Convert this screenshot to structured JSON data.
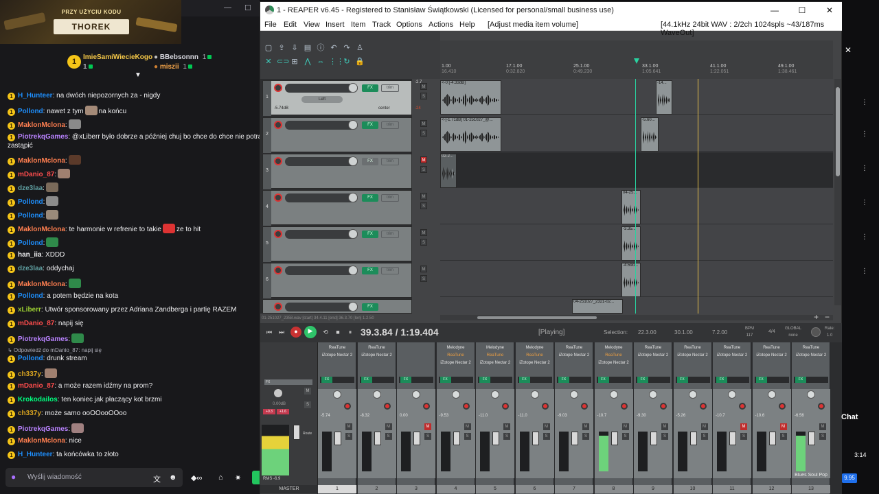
{
  "promo": {
    "top_text": "PRZY UŻYCIU KODU",
    "code": "THOREK"
  },
  "leaders": {
    "first_name": "ImieSamiWiecieKogo",
    "first_count": "1",
    "second_name": "BBebsonnn",
    "second_count": "1",
    "third_name": "miszii",
    "third_count": "1"
  },
  "chat": {
    "messages": [
      {
        "user": "H_Hunteer",
        "color": "#1e90ff",
        "text": ": na dwóch niepozornych za - nigdy"
      },
      {
        "user": "Pollond",
        "color": "#1e90ff",
        "text": ": nawet z tym",
        "after": "na końcu"
      },
      {
        "user": "MaklonMclona",
        "color": "#ff7f50",
        "text": ":"
      },
      {
        "user": "PiotrekqGames",
        "color": "#b983ff",
        "text": ": @xLiberr było dobrze a później chuj bo chce do chce nie potrafię"
      },
      {
        "user": "",
        "color": "#efeff1",
        "text": "zastąpić"
      },
      {
        "user": "MaklonMclona",
        "color": "#ff7f50",
        "text": ":"
      },
      {
        "user": "mDanio_87",
        "color": "#ff4d4d",
        "text": ":"
      },
      {
        "user": "dze3laa",
        "color": "#5f9ea0",
        "text": ":"
      },
      {
        "user": "Pollond",
        "color": "#1e90ff",
        "text": ":"
      },
      {
        "user": "Pollond",
        "color": "#1e90ff",
        "text": ":"
      },
      {
        "user": "MaklonMclona",
        "color": "#ff7f50",
        "text": ": te harmonie w refrenie to takie",
        "after": "ze to hit"
      },
      {
        "user": "Pollond",
        "color": "#1e90ff",
        "text": ":"
      },
      {
        "user": "han_iia",
        "color": "#efeff1",
        "text": ": XDDD"
      },
      {
        "user": "dze3laa",
        "color": "#5f9ea0",
        "text": ": oddychaj"
      },
      {
        "user": "MaklonMclona",
        "color": "#ff7f50",
        "text": ":"
      },
      {
        "user": "Pollond",
        "color": "#1e90ff",
        "text": ": a potem będzie na kota"
      },
      {
        "user": "xLiberr",
        "color": "#9acd32",
        "text": ": Utwór sponsorowany przez Adriana Zandberga i partię RAZEM"
      },
      {
        "user": "mDanio_87",
        "color": "#ff4d4d",
        "text": ": napij się"
      },
      {
        "user": "PiotrekqGames",
        "color": "#b983ff",
        "text": ":"
      },
      {
        "user": "",
        "color": "#adadb8",
        "text": "↳ Odpowiedź do mDanio_87: napij się"
      },
      {
        "user": "Pollond",
        "color": "#1e90ff",
        "text": ": drunk stream"
      },
      {
        "user": "ch337y",
        "color": "#daa520",
        "text": ":"
      },
      {
        "user": "mDanio_87",
        "color": "#ff4d4d",
        "text": ": a może razem idźmy na prom?"
      },
      {
        "user": "Krokodailos",
        "color": "#00ff7f",
        "text": ": ten koniec jak płaczący kot brzmi"
      },
      {
        "user": "ch337y",
        "color": "#daa520",
        "text": ": może samo ooOOooOOoo"
      },
      {
        "user": "PiotrekqGames",
        "color": "#b983ff",
        "text": ":"
      },
      {
        "user": "MaklonMclona",
        "color": "#ff7f50",
        "text": ": nice"
      },
      {
        "user": "H_Hunteer",
        "color": "#1e90ff",
        "text": ": ta końcówka to złoto"
      }
    ],
    "input_placeholder": "Wyślij wiadomość"
  },
  "reaper": {
    "title": "1 - REAPER v6.45 - Registered to Stanisław Świątkowski (Licensed for personal/small business use)",
    "menu": [
      "File",
      "Edit",
      "View",
      "Insert",
      "Item",
      "Track",
      "Options",
      "Actions",
      "Help",
      "[Adjust media item volume]"
    ],
    "format_info": "[44.1kHz 24bit WAV : 2/2ch 1024spls ~43/187ms WaveOut]",
    "ruler": [
      {
        "bar": "1.00",
        "time": "16.410"
      },
      {
        "bar": "17.1.00",
        "time": "0:32.820"
      },
      {
        "bar": "25.1.00",
        "time": "0:49.230"
      },
      {
        "bar": "33.1.00",
        "time": "1:05.641"
      },
      {
        "bar": "41.1.00",
        "time": "1:22.051"
      },
      {
        "bar": "49.1.00",
        "time": "1:38.461"
      }
    ],
    "track1": {
      "pan": "Left",
      "vol": "-5.74dB",
      "center": "center",
      "meter": "-2.7",
      "meter2": "-24"
    },
    "tracks": [
      "1",
      "2",
      "3",
      "4",
      "5",
      "6"
    ],
    "items": [
      {
        "label": "<-0:[-4.33dB]"
      },
      {
        "label": "-14..."
      },
      {
        "label": "<-[-1.71dB] 01-251027_@..."
      },
      {
        "label": "-5.60..."
      },
      {
        "label": "02-2..."
      },
      {
        "label": "04-25..."
      },
      {
        "label": "-3.35..."
      },
      {
        "label": "-4.59d..."
      },
      {
        "label": "04-251027_2321-02..."
      }
    ],
    "status_line": "01-251027_2358.wav [start] 34.4.11 [end] 36.3.70 [len] 1.2.50",
    "transport": {
      "time": "39.3.84 / 1:19.404",
      "state": "[Playing]",
      "selection_label": "Selection:",
      "sel_start": "22.3.00",
      "sel_end": "30.1.00",
      "sel_len": "7.2.00",
      "bpm_label": "BPM",
      "bpm": "117",
      "sig": "4/4",
      "global": "GLOBAL",
      "none": "none",
      "rate_label": "Rate:",
      "rate": "1.0"
    },
    "mixer": {
      "master_label": "MASTER",
      "master_db": "0.00dB",
      "master_peaks": [
        "+0.3",
        "+1.6"
      ],
      "rms_label": "RMS",
      "rms_value": "-6.9",
      "strips": [
        {
          "num": "1",
          "fx": [
            "ReaTune",
            "iZotope Nectar 2"
          ],
          "db": "-5.74",
          "mute": false,
          "hot": false,
          "sel": true
        },
        {
          "num": "2",
          "fx": [
            "ReaTune",
            "iZotope Nectar 2"
          ],
          "db": "-8.32",
          "mute": false,
          "hot": false,
          "sel": false
        },
        {
          "num": "3",
          "fx": [],
          "db": "0.00",
          "mute": true,
          "hot": false,
          "sel": false
        },
        {
          "num": "4",
          "fx": [
            "Melodyne",
            "ReaTune",
            "iZotope Nectar 2"
          ],
          "db": "-9.53",
          "mute": false,
          "hot": false,
          "sel": false
        },
        {
          "num": "5",
          "fx": [
            "Melodyne",
            "ReaTune",
            "iZotope Nectar 2"
          ],
          "db": "-11.0",
          "mute": false,
          "hot": false,
          "sel": false
        },
        {
          "num": "6",
          "fx": [
            "Melodyne",
            "ReaTune",
            "iZotope Nectar 2"
          ],
          "db": "-11.0",
          "mute": false,
          "hot": false,
          "sel": false
        },
        {
          "num": "7",
          "fx": [
            "ReaTune",
            "iZotope Nectar 2"
          ],
          "db": "-9.03",
          "mute": false,
          "hot": false,
          "sel": false
        },
        {
          "num": "8",
          "fx": [
            "Melodyne",
            "ReaTune",
            "iZotope Nectar 2"
          ],
          "db": "-10.7",
          "mute": false,
          "hot": true,
          "sel": false
        },
        {
          "num": "9",
          "fx": [
            "ReaTune",
            "iZotope Nectar 2"
          ],
          "db": "-9.30",
          "mute": false,
          "hot": false,
          "sel": false
        },
        {
          "num": "10",
          "fx": [
            "ReaTune",
            "iZotope Nectar 2"
          ],
          "db": "-5.26",
          "mute": false,
          "hot": false,
          "sel": false
        },
        {
          "num": "11",
          "fx": [
            "ReaTune",
            "iZotope Nectar 2"
          ],
          "db": "-10.7",
          "mute": true,
          "hot": false,
          "sel": false
        },
        {
          "num": "12",
          "fx": [
            "ReaTune",
            "iZotope Nectar 2"
          ],
          "db": "-10.6",
          "mute": true,
          "hot": false,
          "sel": false
        },
        {
          "num": "13",
          "fx": [
            "ReaTune",
            "iZotope Nectar 2"
          ],
          "db": "-6.56",
          "mute": false,
          "hot": true,
          "sel": false,
          "name": "Blues Soul Pop"
        }
      ]
    }
  },
  "right": {
    "chat_label": "Chat",
    "time": "3:14",
    "price": "9.95"
  }
}
